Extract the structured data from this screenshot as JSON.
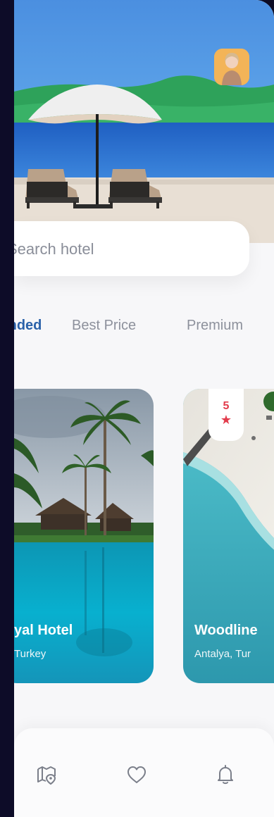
{
  "search": {
    "placeholder": "Search hotel"
  },
  "tabs": [
    {
      "label": "Recommended",
      "visible_text": "ed",
      "active": true
    },
    {
      "label": "Best Price",
      "active": false
    },
    {
      "label": "Premium",
      "active": false
    }
  ],
  "hotels": [
    {
      "name": "Royal Hotel",
      "visible_name": "yal Hotel",
      "location": "Turkey",
      "visible_location": "Turkey"
    },
    {
      "name": "Woodline",
      "visible_name": "Woodline",
      "location": "Antalya, Turkey",
      "visible_location": "Antalya, Tur",
      "rating": "5",
      "rating_icon": "star-icon"
    }
  ],
  "bottom_nav": [
    {
      "icon": "map-pin-icon"
    },
    {
      "icon": "heart-icon"
    },
    {
      "icon": "bell-icon"
    }
  ],
  "colors": {
    "accent": "#2a61a9",
    "rating": "#e23b4b",
    "background": "#f7f7f9"
  }
}
